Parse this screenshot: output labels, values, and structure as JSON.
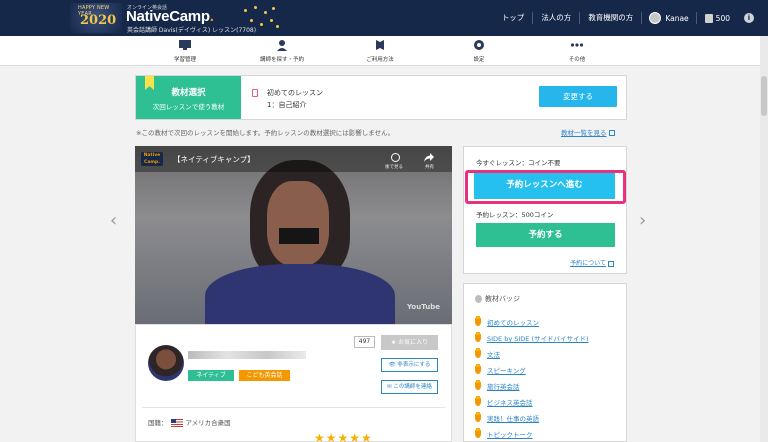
{
  "header": {
    "new_year_small": "HAPPY NEW YEAR",
    "new_year_year": "2020",
    "brand_tagline": "オンライン英会話",
    "brand_name": "NativeCamp",
    "brand_dot": ".",
    "teacher_line": "英会話講師 Davis(デイヴィス) レッスン(7708)",
    "links": [
      "トップ",
      "法人の方",
      "教育機関の方"
    ],
    "user_name": "Kanae",
    "coins": "500",
    "info_label": "i"
  },
  "nav": {
    "items": [
      {
        "label": "学習管理",
        "icon": "monitor-icon"
      },
      {
        "label": "講師を探す・予約",
        "icon": "teacher-icon"
      },
      {
        "label": "ご利用方法",
        "icon": "guide-icon"
      },
      {
        "label": "設定",
        "icon": "gear-icon"
      },
      {
        "label": "その他",
        "icon": "more-icon"
      }
    ]
  },
  "material": {
    "title": "教材選択",
    "subtitle": "次回レッスンで使う教材",
    "lesson_name": "初めてのレッスン",
    "lesson_unit": "1：自己紹介",
    "change_button": "変更する",
    "note": "※この教材で次回のレッスンを開始します。予約レッスンの教材選択には影響しません。",
    "list_link": "教材一覧を見る"
  },
  "video": {
    "logo_line1": "Native",
    "logo_line2": "Camp.",
    "title": "【ネイティブキャンプ】",
    "watch_later": "後で見る",
    "share": "共有",
    "youtube": "YouTube"
  },
  "teacher": {
    "favorite_count": "497",
    "favorite_button": "★ お気に入り",
    "hide_button": "👁 非表示にする",
    "contact_button": "✉ この講師を連絡",
    "tag_native": "ネイティブ",
    "tag_kids": "こども英会話",
    "country_label": "国籍：",
    "country": "アメリカ合衆国",
    "stars": "★★★★★"
  },
  "reserve": {
    "now_label": "今すぐレッスン：コイン不要",
    "now_button": "予約レッスンへ進む",
    "reserve_label": "予約レッスン：500コイン",
    "reserve_button": "予約する",
    "about_link": "予約について"
  },
  "badges": {
    "title": "教材バッジ",
    "items": [
      "初めてのレッスン",
      "SIDE by SIDE (サイドバイサイド)",
      "文法",
      "スピーキング",
      "旅行英会話",
      "ビジネス英会話",
      "実践！仕事の英語",
      "トピックトーク"
    ]
  },
  "colors": {
    "header_bg": "#15284a",
    "accent_green": "#2ebf93",
    "accent_blue": "#26b6ec",
    "highlight_pink": "#e8327d",
    "orange": "#f39800"
  }
}
